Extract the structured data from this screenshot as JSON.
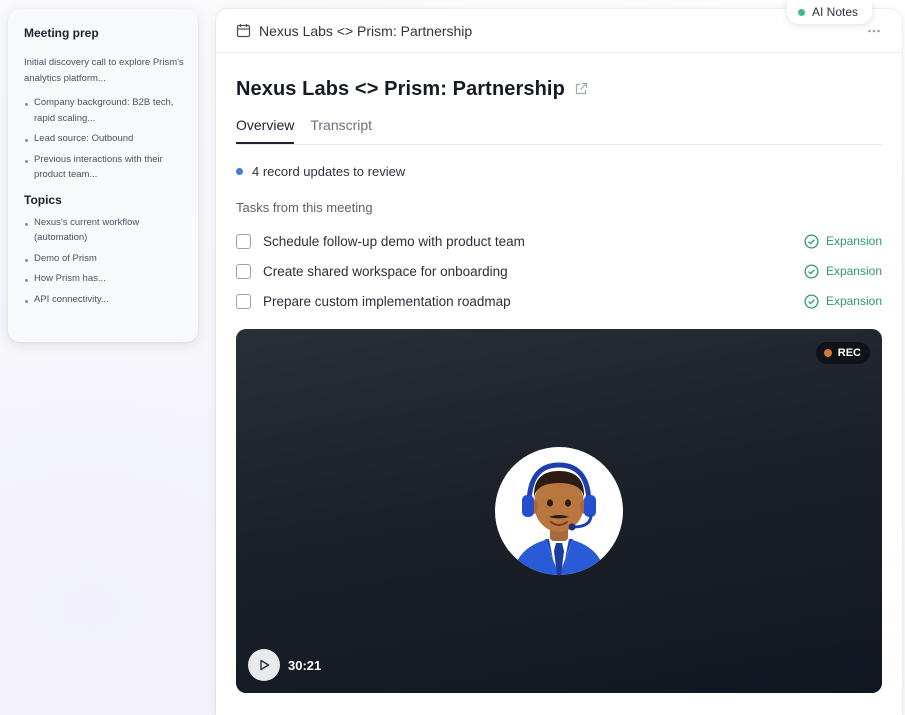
{
  "prep": {
    "title": "Meeting prep",
    "intro": "Initial discovery call to explore Prism's analytics platform...",
    "items": [
      "Company background: B2B tech, rapid scaling...",
      "Lead source: Outbound",
      "Previous interactions with their product team..."
    ],
    "topics_title": "Topics",
    "topics": [
      "Nexus's current workflow (automation)",
      "Demo of Prism",
      "How Prism has...",
      "API connectivity..."
    ]
  },
  "header": {
    "title": "Nexus Labs <> Prism: Partnership",
    "calendar_icon": "calendar-icon",
    "more_icon": "more-horizontal-icon"
  },
  "ai_notes": {
    "label": "AI Notes",
    "status_color": "#3dbb8c"
  },
  "meeting": {
    "title": "Nexus Labs <> Prism: Partnership",
    "external_icon": "external-link-icon"
  },
  "tabs": [
    {
      "label": "Overview",
      "active": true
    },
    {
      "label": "Transcript",
      "active": false
    }
  ],
  "updates": {
    "text": "4 record updates to review",
    "dot_color": "#3b7fd8"
  },
  "tasks_label": "Tasks from this meeting",
  "tasks": [
    {
      "text": "Schedule follow-up demo with product team",
      "tag": "Expansion",
      "checked": false
    },
    {
      "text": "Create shared workspace for onboarding",
      "tag": "Expansion",
      "checked": false
    },
    {
      "text": "Prepare custom implementation roadmap",
      "tag": "Expansion",
      "checked": false
    }
  ],
  "video": {
    "rec_label": "REC",
    "rec_color": "#d9763a",
    "duration": "30:21",
    "play_icon": "play-icon"
  },
  "colors": {
    "accent_green": "#2e9a6e",
    "text_primary": "#161a24"
  }
}
